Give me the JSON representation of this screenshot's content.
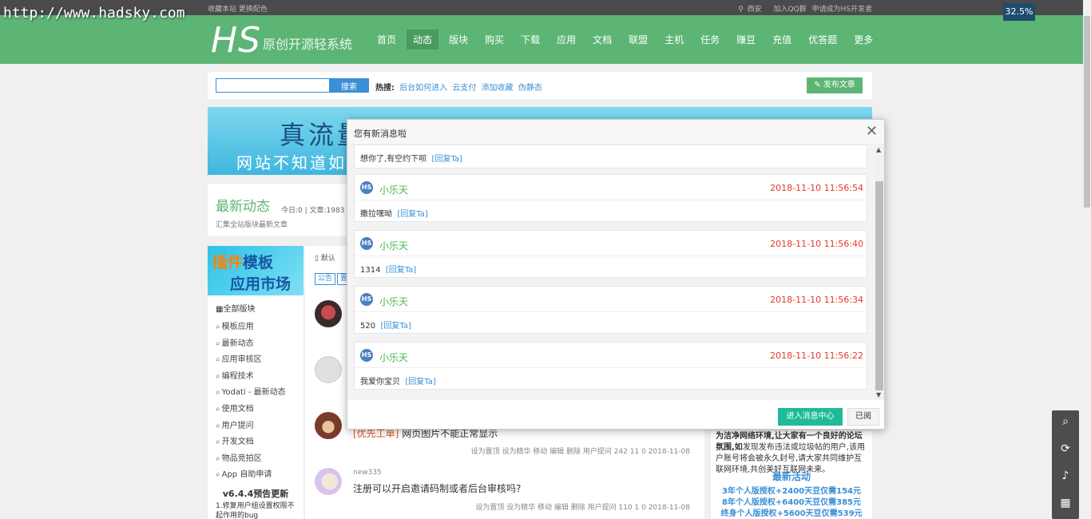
{
  "watermark": "http://www.hadsky.com",
  "zoom": "32.5%",
  "topbar": {
    "left": "收藏本站  更换配色",
    "location": "西安",
    "qq": "加入QQ群",
    "dev": "申请成为HS开发者"
  },
  "logo": {
    "main": "HS",
    "sub": "原创开源轻系统"
  },
  "nav": [
    "首页",
    "动态",
    "版块",
    "购买",
    "下载",
    "应用",
    "文档",
    "联盟",
    "主机",
    "任务",
    "赚豆",
    "充值",
    "优答题",
    "更多"
  ],
  "search": {
    "button": "搜索",
    "hot_label": "热搜:",
    "hot": [
      "后台如何进入",
      "云支付",
      "添加收藏",
      "伪静态"
    ],
    "publish": "发布文章"
  },
  "banner": {
    "line1": "真流量",
    "line2": "网站不知道如何"
  },
  "latest": {
    "title": "最新动态",
    "stats": "今日:0  |  文章:1983",
    "desc": "汇集全站版块最新文章"
  },
  "sidebar": {
    "banner_1a": "插件",
    "banner_1b": "模板",
    "banner_2": "应用市场",
    "all": "全部版块",
    "items": [
      "模板应用",
      "最新动态",
      "应用审核区",
      "编程技术",
      "Yodati - 最新动态",
      "使用文档",
      "用户提问",
      "开发文档",
      "物品竞拍区",
      "App 自助申请"
    ],
    "update_title": "v6.4.4预告更新",
    "update_note": "1.修复用户组设置权限不起作用的bug"
  },
  "main": {
    "default_label": "默认",
    "tags": [
      "公告",
      "置"
    ],
    "posts": [
      {
        "user": "",
        "tag": "",
        "title": "",
        "meta": ""
      },
      {
        "user": "",
        "tag": "",
        "title": "",
        "meta": ""
      },
      {
        "user": "",
        "tag": "[优先工单]",
        "title": "网页图片不能正常显示",
        "meta": "设为置顶 设为精华 移动 编辑 删除   用户提问   242   11   0   2018-11-08"
      },
      {
        "user": "new335",
        "tag": "",
        "title": "注册可以开启邀请码制或者后台审核吗?",
        "meta": "设为置顶 设为精华 移动 编辑 删除   用户提问   110   1   0   2018-11-08"
      }
    ]
  },
  "rightpanel": {
    "text_bold": "为洁净网络环境,让大家有一个良好的论坛氛围,如",
    "text": "发现发布违法或垃圾帖的用户,该用户账号将会被永久封号,请大家共同维护互联网环境,共创美好互联网未来。",
    "title": "最新活动",
    "lines": [
      "3年个人版授权+2400天豆仅需154元",
      "8年个人版授权+6400天豆仅需385元",
      "终身个人版授权+5600天豆仅需539元"
    ]
  },
  "modal": {
    "title": "您有新消息啦",
    "reply_label": "[回复Ta]",
    "top_partial_text": "想你了,有空约下呗",
    "messages": [
      {
        "name": "小乐天",
        "time": "2018-11-10 11:56:54",
        "text": "撒拉嘿呦"
      },
      {
        "name": "小乐天",
        "time": "2018-11-10 11:56:40",
        "text": "1314"
      },
      {
        "name": "小乐天",
        "time": "2018-11-10 11:56:34",
        "text": "520"
      },
      {
        "name": "小乐天",
        "time": "2018-11-10 11:56:22",
        "text": "我爱你宝贝"
      }
    ],
    "btn_center": "进入消息中心",
    "btn_read": "已阅"
  },
  "colors": {
    "brand_green": "#5cb574",
    "link_blue": "#3a8fd6",
    "time_red": "#e03b2a",
    "teal_button": "#1dbb97"
  }
}
